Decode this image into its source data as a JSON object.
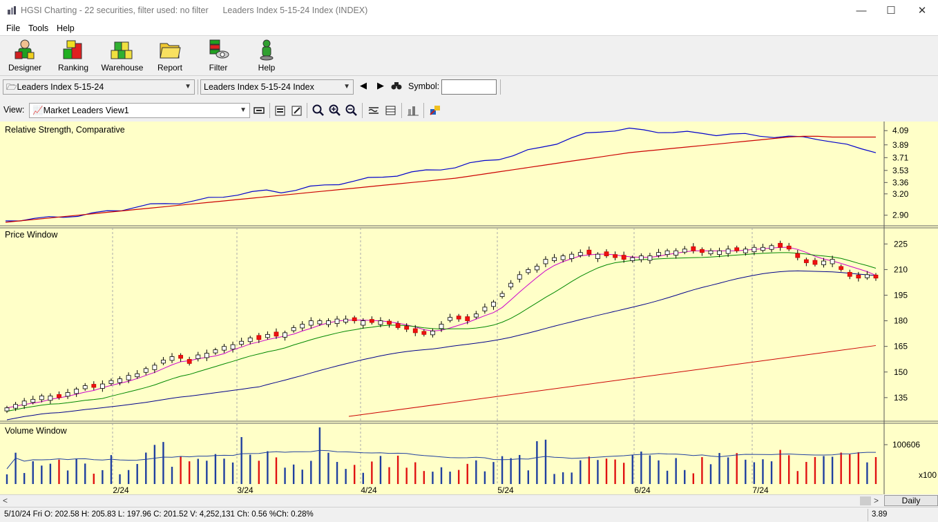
{
  "window": {
    "title": "HGSI Charting - 22 securities, filter used: no filter      Leaders Index 5-15-24 Index (INDEX)",
    "minimize": "—",
    "maximize": "☐",
    "close": "✕"
  },
  "menu": {
    "file": "File",
    "tools": "Tools",
    "help": "Help"
  },
  "toolbar": {
    "designer": "Designer",
    "ranking": "Ranking",
    "warehouse": "Warehouse",
    "report": "Report",
    "filter": "Filter",
    "help": "Help"
  },
  "selection": {
    "list_combo": "Leaders Index 5-15-24",
    "security_combo": "Leaders Index 5-15-24 Index",
    "symbol_label": "Symbol:",
    "symbol_value": ""
  },
  "view": {
    "label": "View:",
    "combo": "Market Leaders View1"
  },
  "panels": {
    "rs_title": "Relative Strength, Comparative",
    "price_title": "Price Window",
    "volume_title": "Volume Window",
    "volume_multiplier": "x100"
  },
  "chart_data": [
    {
      "type": "line",
      "title": "Relative Strength, Comparative",
      "y_ticks": [
        "4.09",
        "3.89",
        "3.71",
        "3.53",
        "3.36",
        "3.20",
        "2.90"
      ],
      "series": [
        {
          "color": "#0000cc",
          "values": [
            2.82,
            2.84,
            2.85,
            2.86,
            2.88,
            2.9,
            2.92,
            2.95,
            2.98,
            3.02,
            3.04,
            3.06,
            3.08,
            3.1,
            3.13,
            3.16,
            3.2,
            3.22,
            3.24,
            3.23,
            3.26,
            3.29,
            3.32,
            3.35,
            3.38,
            3.41,
            3.44,
            3.47,
            3.5,
            3.52,
            3.55,
            3.58,
            3.62,
            3.66,
            3.7,
            3.74,
            3.8,
            3.86,
            3.92,
            3.98,
            4.04,
            4.08,
            4.1,
            4.11,
            4.09,
            4.08,
            4.07,
            4.06,
            4.05,
            4.04,
            4.04,
            4.03,
            4.02,
            4.01,
            4.0,
            3.99,
            3.98,
            3.94,
            3.88,
            3.83,
            3.8
          ]
        },
        {
          "color": "#cc0000",
          "values": [
            2.8,
            2.82,
            2.84,
            2.86,
            2.88,
            2.9,
            2.92,
            2.94,
            2.96,
            2.98,
            3.0,
            3.02,
            3.04,
            3.06,
            3.08,
            3.1,
            3.12,
            3.14,
            3.16,
            3.18,
            3.2,
            3.22,
            3.24,
            3.26,
            3.28,
            3.3,
            3.32,
            3.34,
            3.36,
            3.38,
            3.4,
            3.42,
            3.45,
            3.48,
            3.51,
            3.54,
            3.57,
            3.6,
            3.63,
            3.66,
            3.69,
            3.72,
            3.75,
            3.78,
            3.8,
            3.82,
            3.84,
            3.86,
            3.88,
            3.9,
            3.92,
            3.94,
            3.96,
            3.98,
            4.0,
            4.01,
            4.01,
            4.0,
            4.0,
            4.0,
            4.0
          ]
        }
      ]
    },
    {
      "type": "candlestick",
      "title": "Price Window",
      "y_ticks": [
        225,
        210,
        195,
        180,
        165,
        150,
        135
      ],
      "x_ticks": [
        "2/24",
        "3/24",
        "4/24",
        "5/24",
        "6/24",
        "7/24"
      ],
      "candles": [
        129,
        131,
        133,
        134,
        136,
        136,
        135,
        138,
        140,
        142,
        141,
        143,
        145,
        146,
        148,
        149,
        152,
        154,
        157,
        159,
        158,
        155,
        160,
        161,
        163,
        165,
        166,
        168,
        170,
        169,
        172,
        171,
        173,
        176,
        178,
        180,
        180,
        180,
        181,
        181,
        180,
        180,
        179,
        180,
        178,
        176,
        175,
        173,
        172,
        174,
        178,
        182,
        181,
        180,
        184,
        188,
        191,
        196,
        202,
        207,
        210,
        212,
        216,
        217,
        218,
        219,
        220,
        219,
        219,
        218,
        217,
        216,
        217,
        218,
        218,
        220,
        221,
        221,
        222,
        221,
        220,
        221,
        221,
        222,
        221,
        222,
        223,
        223,
        224,
        223,
        222,
        217,
        214,
        213,
        215,
        216,
        210,
        206,
        205,
        207,
        205
      ],
      "ma_series": [
        {
          "color": "#cc00cc",
          "label": "short"
        },
        {
          "color": "#008800",
          "label": "medium"
        },
        {
          "color": "#00008b",
          "label": "long"
        },
        {
          "color": "#cc0000",
          "label": "very long"
        }
      ],
      "last_close": 201.52
    },
    {
      "type": "bar",
      "title": "Volume Window",
      "y_ticks": [
        "100606"
      ],
      "multiplier": "x100"
    }
  ],
  "bottom": {
    "interval": "Daily"
  },
  "status": {
    "info": "5/10/24 Fri O: 202.58 H: 205.83 L: 197.96 C: 201.52 V: 4,252,131 Ch: 0.56 %Ch: 0.28%",
    "value": "3.89"
  }
}
